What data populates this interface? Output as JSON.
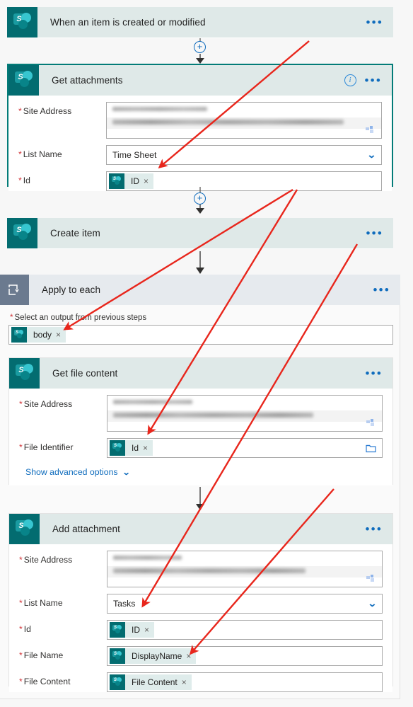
{
  "flow": {
    "steps": [
      {
        "id": "trigger",
        "title": "When an item is created or modified",
        "icon": "sharepoint-icon",
        "menu": "•••",
        "collapsed": true
      },
      {
        "id": "get-attachments",
        "title": "Get attachments",
        "icon": "sharepoint-icon",
        "menu": "•••",
        "info": "i",
        "selected": true,
        "fields": [
          {
            "label": "Site Address",
            "required": true,
            "type": "blurred",
            "value": ""
          },
          {
            "label": "List Name",
            "required": true,
            "type": "dropdown",
            "value": "Time Sheet"
          },
          {
            "label": "Id",
            "required": true,
            "type": "token",
            "token": "ID",
            "remove": "×"
          }
        ]
      },
      {
        "id": "create-item",
        "title": "Create item",
        "icon": "sharepoint-icon",
        "menu": "•••",
        "collapsed": true
      },
      {
        "id": "apply-to-each",
        "title": "Apply to each",
        "icon": "loop-icon",
        "menu": "•••",
        "select_output_label": "Select an output from previous steps",
        "select_output_required": true,
        "select_output_token": "body",
        "select_output_remove": "×"
      },
      {
        "id": "get-file-content",
        "title": "Get file content",
        "icon": "sharepoint-icon",
        "menu": "•••",
        "fields": [
          {
            "label": "Site Address",
            "required": true,
            "type": "blurred",
            "value": ""
          },
          {
            "label": "File Identifier",
            "required": true,
            "type": "token",
            "token": "Id",
            "remove": "×",
            "picker": "folder-icon"
          }
        ],
        "advanced_link": "Show advanced options"
      },
      {
        "id": "add-attachment",
        "title": "Add attachment",
        "icon": "sharepoint-icon",
        "menu": "•••",
        "fields": [
          {
            "label": "Site Address",
            "required": true,
            "type": "blurred",
            "value": ""
          },
          {
            "label": "List Name",
            "required": true,
            "type": "dropdown",
            "value": "Tasks"
          },
          {
            "label": "Id",
            "required": true,
            "type": "token",
            "token": "ID",
            "remove": "×"
          },
          {
            "label": "File Name",
            "required": true,
            "type": "token",
            "token": "DisplayName",
            "remove": "×"
          },
          {
            "label": "File Content",
            "required": true,
            "type": "token",
            "token": "File Content",
            "remove": "×"
          }
        ]
      }
    ],
    "connectors": [
      {
        "type": "insert-step",
        "symbol": "+"
      },
      {
        "type": "insert-step",
        "symbol": "+"
      }
    ]
  },
  "annotations": {
    "color": "#e8261c",
    "arrows": [
      {
        "name": "arrow-to-get-attachments-id"
      },
      {
        "name": "arrow-to-apply-to-each-body"
      },
      {
        "name": "arrow-to-get-file-content-id"
      },
      {
        "name": "arrow-to-add-attachment-id"
      },
      {
        "name": "arrow-to-add-attachment-file-content"
      }
    ]
  },
  "colors": {
    "sharepoint_teal": "#036c70",
    "header_bar": "#dfe9e8",
    "scope_header": "#e6eaee",
    "accent_blue": "#0f6cbd",
    "required_red": "#d13438",
    "annotation_red": "#e8261c",
    "page_background": "#f7f7f7"
  }
}
